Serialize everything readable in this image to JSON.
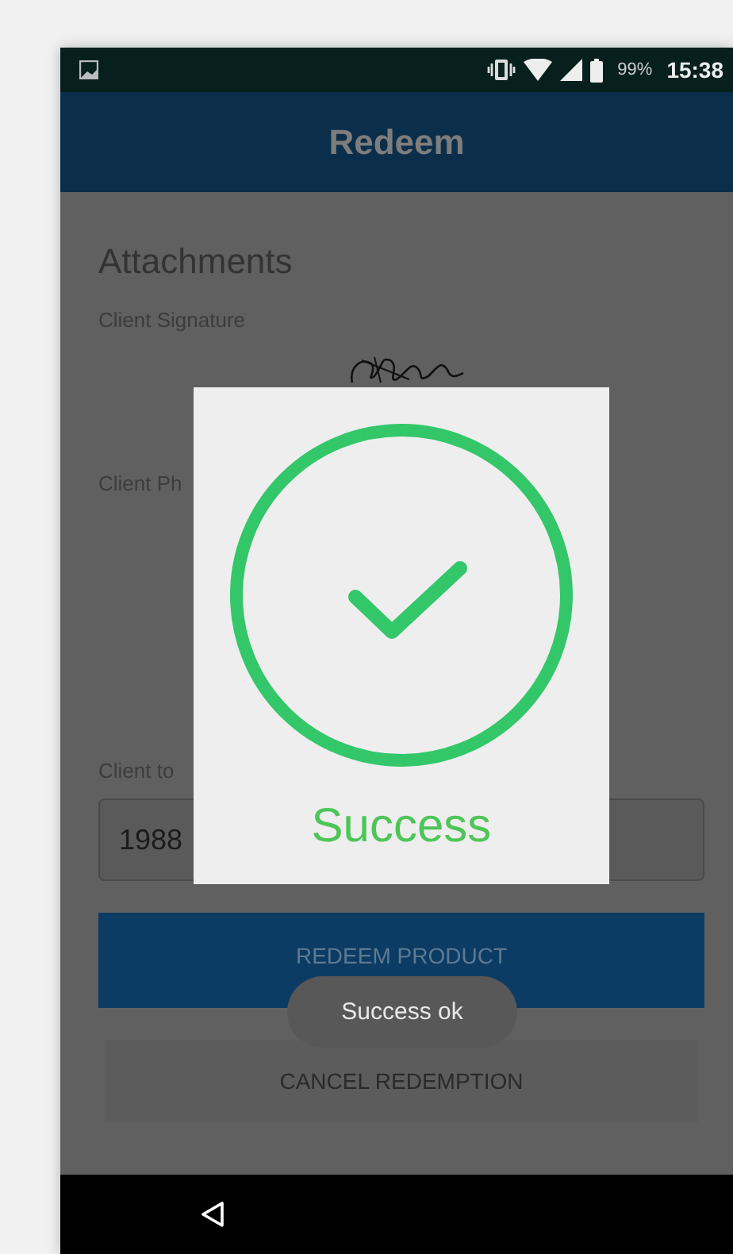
{
  "status_bar": {
    "battery": "99%",
    "time": "15:38"
  },
  "app_bar": {
    "title": "Redeem"
  },
  "form": {
    "heading": "Attachments",
    "signature_label": "Client Signature",
    "photo_label": "Client Ph",
    "field_label": "Client to",
    "field_value": "1988"
  },
  "buttons": [
    {
      "label": "REDEEM PRODUCT",
      "kind": "primary"
    },
    {
      "label": "CANCEL REDEMPTION",
      "kind": "secondary"
    }
  ],
  "dialog": {
    "message": "Success"
  },
  "toast": {
    "message": "Success ok"
  }
}
